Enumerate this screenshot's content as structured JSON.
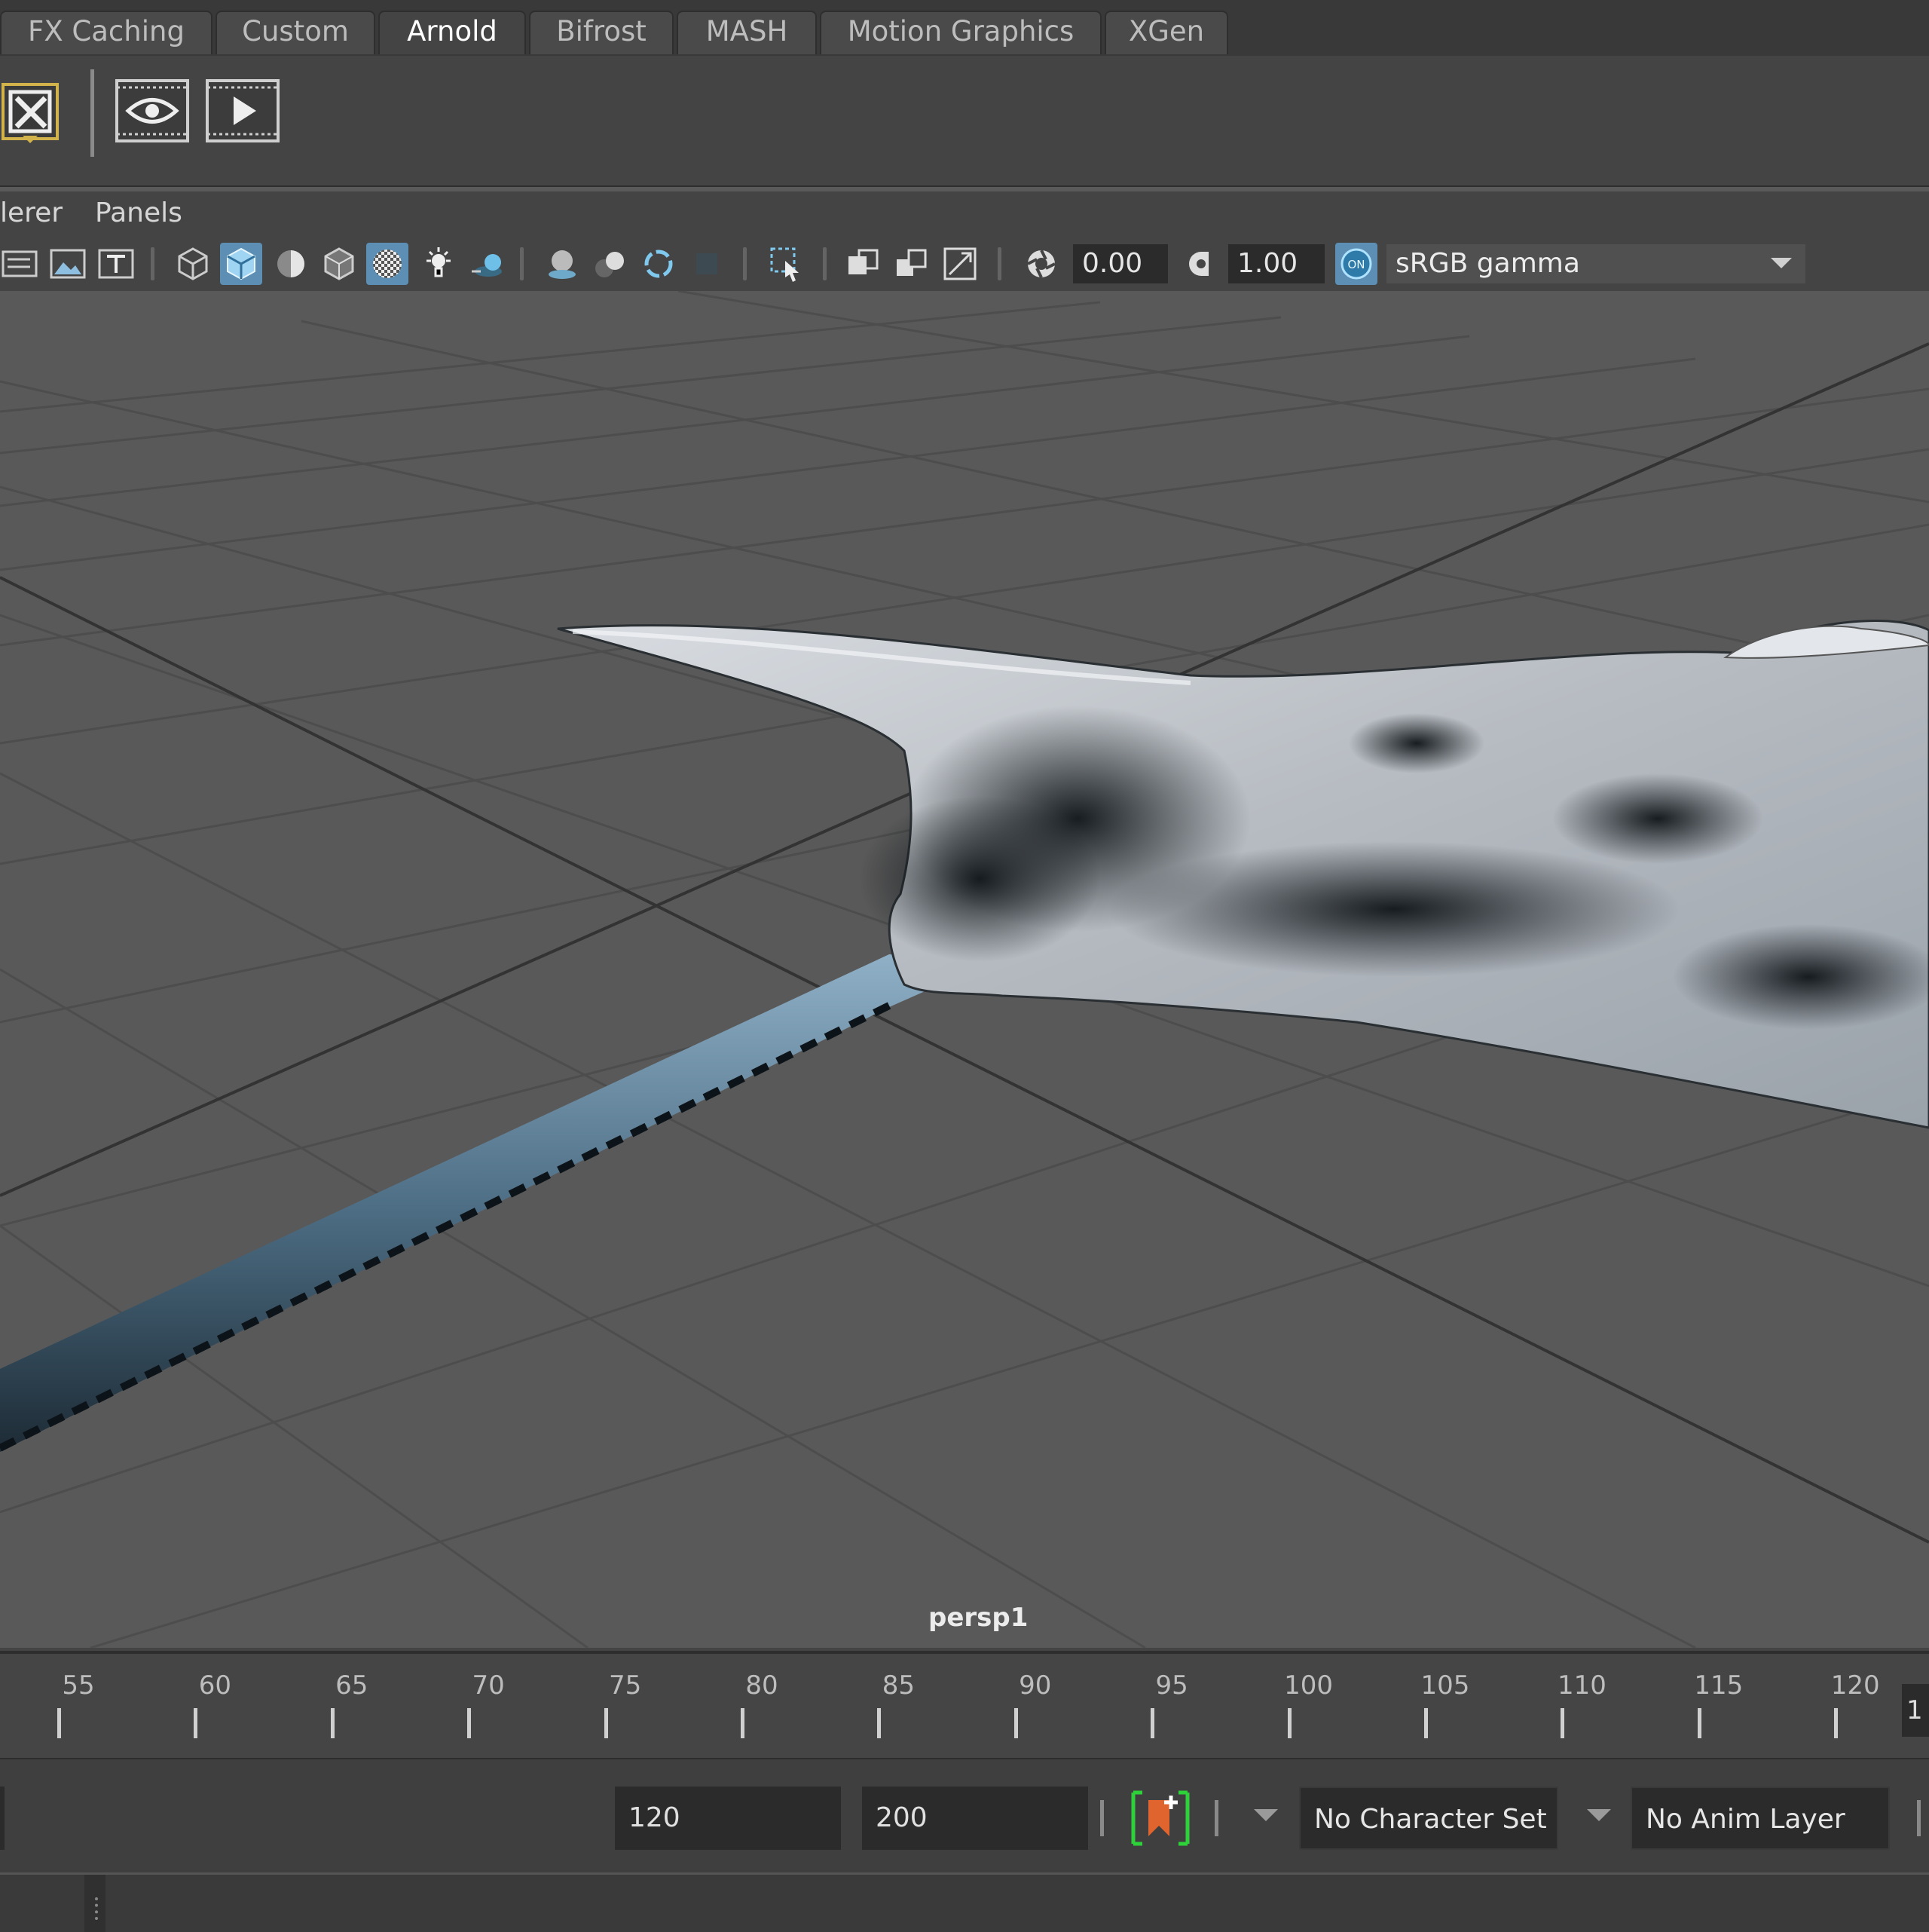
{
  "shelf": {
    "tabs": [
      {
        "label": "FX Caching",
        "active": false
      },
      {
        "label": "Custom",
        "active": false
      },
      {
        "label": "Arnold",
        "active": true
      },
      {
        "label": "Bifrost",
        "active": false
      },
      {
        "label": "MASH",
        "active": false
      },
      {
        "label": "Motion Graphics",
        "active": false
      },
      {
        "label": "XGen",
        "active": false
      }
    ],
    "buttons": [
      "arnold-light-icon",
      "render-view-icon",
      "render-play-icon"
    ]
  },
  "panel_menu": {
    "renderer_label": "lerer",
    "panels_label": "Panels"
  },
  "panel_toolbar": {
    "exposure_value": "0.00",
    "gamma_value": "1.00",
    "color_mgmt_badge": "ON",
    "color_space": "sRGB gamma"
  },
  "viewport": {
    "camera": "persp1"
  },
  "timeline": {
    "ticks": [
      "55",
      "60",
      "65",
      "70",
      "75",
      "80",
      "85",
      "90",
      "95",
      "100",
      "105",
      "110",
      "115",
      "120"
    ],
    "current_frame_partial": "1"
  },
  "range": {
    "end_frame": "120",
    "total_end": "200",
    "character_set": "No Character Set",
    "anim_layer": "No Anim Layer"
  },
  "colors": {
    "accent": "#5c8fb3",
    "key_green": "#2fd13a",
    "key_orange": "#e0642e"
  }
}
